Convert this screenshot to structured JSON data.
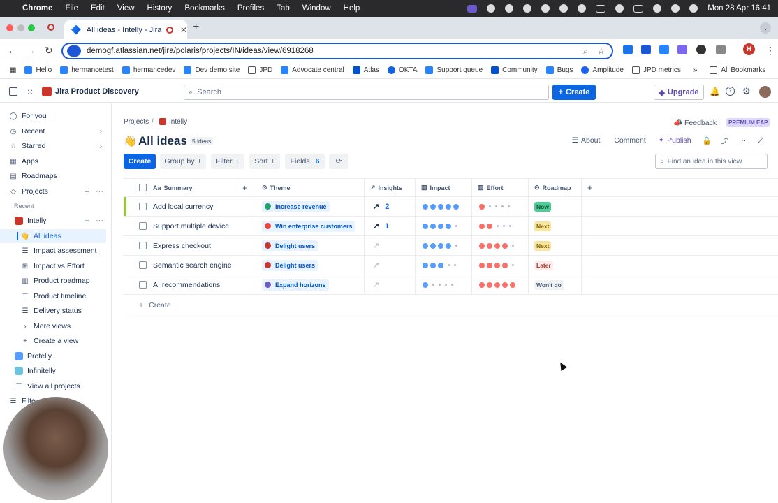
{
  "menubar": {
    "app": "Chrome",
    "items": [
      "File",
      "Edit",
      "View",
      "History",
      "Bookmarks",
      "Profiles",
      "Tab",
      "Window",
      "Help"
    ],
    "clock": "Mon 28 Apr  16:41"
  },
  "browser": {
    "tab_title": "All ideas - Intelly - Jira Pr",
    "url": "demogf.atlassian.net/jira/polaris/projects/IN/ideas/view/6918268",
    "profile_initial": "H",
    "bookmarks": [
      "Hello",
      "hermancetest",
      "hermancedev",
      "Dev demo site",
      "JPD",
      "Advocate central",
      "Atlas",
      "OKTA",
      "Support queue",
      "Community",
      "Bugs",
      "Amplitude",
      "JPD metrics"
    ],
    "all_bookmarks": "All Bookmarks"
  },
  "topbar": {
    "product": "Jira Product Discovery",
    "search_placeholder": "Search",
    "create": "Create",
    "upgrade": "Upgrade"
  },
  "sidebar": {
    "for_you": "For you",
    "recent": "Recent",
    "starred": "Starred",
    "apps": "Apps",
    "roadmaps": "Roadmaps",
    "projects": "Projects",
    "recent_section": "Recent",
    "project": "Intelly",
    "views": [
      "All ideas",
      "Impact assessment",
      "Impact vs Effort",
      "Product roadmap",
      "Product timeline",
      "Delivery status"
    ],
    "more_views": "More views",
    "create_view": "Create a view",
    "other_projects": [
      "Protelly",
      "Infinitelly"
    ],
    "view_all": "View all projects",
    "filters": "Filte"
  },
  "main": {
    "breadcrumb_projects": "Projects",
    "breadcrumb_sep": "/",
    "breadcrumb_project": "Intelly",
    "title": "All ideas",
    "idea_count": "5 ideas",
    "feedback": "Feedback",
    "premium": "PREMIUM EAP",
    "about": "About",
    "comment": "Comment",
    "publish": "Publish",
    "toolbar": {
      "create": "Create",
      "group_by": "Group by",
      "filter": "Filter",
      "sort": "Sort",
      "fields": "Fields",
      "fields_count": "6",
      "find_placeholder": "Find an idea in this view"
    },
    "columns": [
      "Summary",
      "Theme",
      "Insights",
      "Impact",
      "Effort",
      "Roadmap"
    ],
    "rows": [
      {
        "summary": "Add local currency",
        "theme": "Increase revenue",
        "theme_icon": "sprout-icon",
        "theme_color": "#22a06b",
        "insights": "2",
        "impact": 5,
        "effort": 1,
        "roadmap": "Now",
        "roadmap_bg": "#4bce97",
        "roadmap_fg": "#164b35"
      },
      {
        "summary": "Support multiple device",
        "theme": "Win enterprise customers",
        "theme_icon": "target-icon",
        "theme_color": "#e2483d",
        "insights": "1",
        "impact": 4,
        "effort": 2,
        "roadmap": "Next",
        "roadmap_bg": "#f8e6a0",
        "roadmap_fg": "#7f5f01"
      },
      {
        "summary": "Express checkout",
        "theme": "Delight users",
        "theme_icon": "heart-icon",
        "theme_color": "#c9372c",
        "insights": "",
        "impact": 4,
        "effort": 4,
        "roadmap": "Next",
        "roadmap_bg": "#f8e6a0",
        "roadmap_fg": "#7f5f01"
      },
      {
        "summary": "Semantic search engine",
        "theme": "Delight users",
        "theme_icon": "heart-icon",
        "theme_color": "#c9372c",
        "insights": "",
        "impact": 3,
        "effort": 4,
        "roadmap": "Later",
        "roadmap_bg": "#ffeceb",
        "roadmap_fg": "#ae2e24"
      },
      {
        "summary": "AI recommendations",
        "theme": "Expand horizons",
        "theme_icon": "rocket-icon",
        "theme_color": "#6e5dc6",
        "insights": "",
        "impact": 1,
        "effort": 5,
        "roadmap": "Won't do",
        "roadmap_bg": "#f1f2f4",
        "roadmap_fg": "#44546f"
      }
    ],
    "create_row": "Create"
  },
  "colors": {
    "primary": "#0c66e4",
    "impact": "#579dff",
    "effort": "#f87168"
  }
}
